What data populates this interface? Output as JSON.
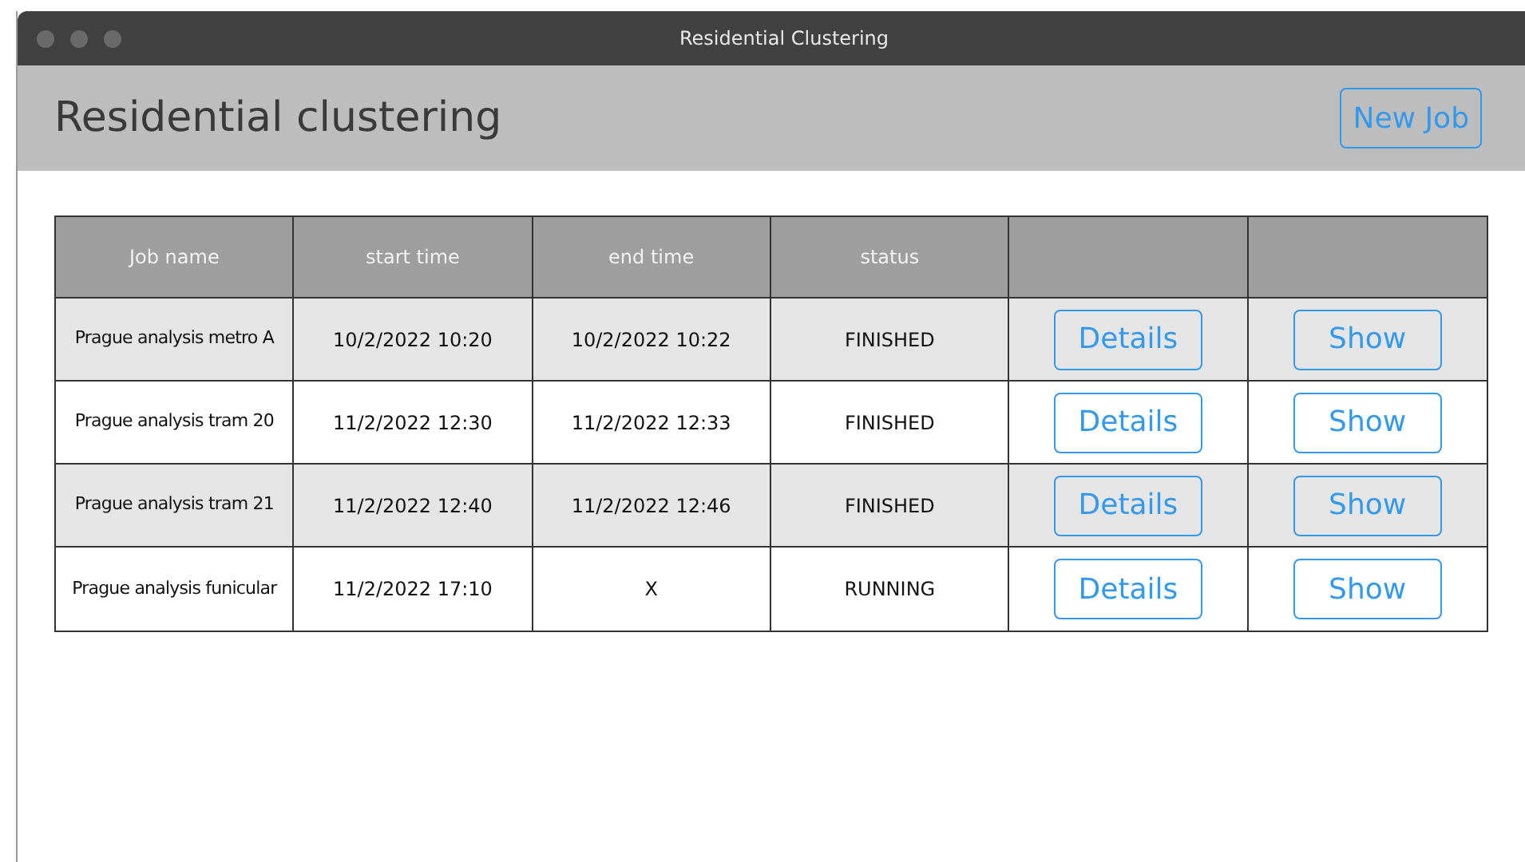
{
  "window": {
    "title": "Residential Clustering"
  },
  "header": {
    "title": "Residential clustering",
    "new_job_button": "New Job"
  },
  "table": {
    "columns": [
      "Job name",
      "start time",
      "end time",
      "status"
    ],
    "rows": [
      {
        "job_name": "Prague analysis metro A",
        "start_time": "10/2/2022 10:20",
        "end_time": "10/2/2022 10:22",
        "status": "FINISHED",
        "details_button": "Details",
        "show_button": "Show"
      },
      {
        "job_name": "Prague analysis tram 20",
        "start_time": "11/2/2022 12:30",
        "end_time": "11/2/2022 12:33",
        "status": "FINISHED",
        "details_button": "Details",
        "show_button": "Show"
      },
      {
        "job_name": "Prague analysis tram 21",
        "start_time": "11/2/2022 12:40",
        "end_time": "11/2/2022 12:46",
        "status": "FINISHED",
        "details_button": "Details",
        "show_button": "Show"
      },
      {
        "job_name": "Prague analysis funicular",
        "start_time": "11/2/2022 17:10",
        "end_time": "X",
        "status": "RUNNING",
        "details_button": "Details",
        "show_button": "Show"
      }
    ]
  }
}
